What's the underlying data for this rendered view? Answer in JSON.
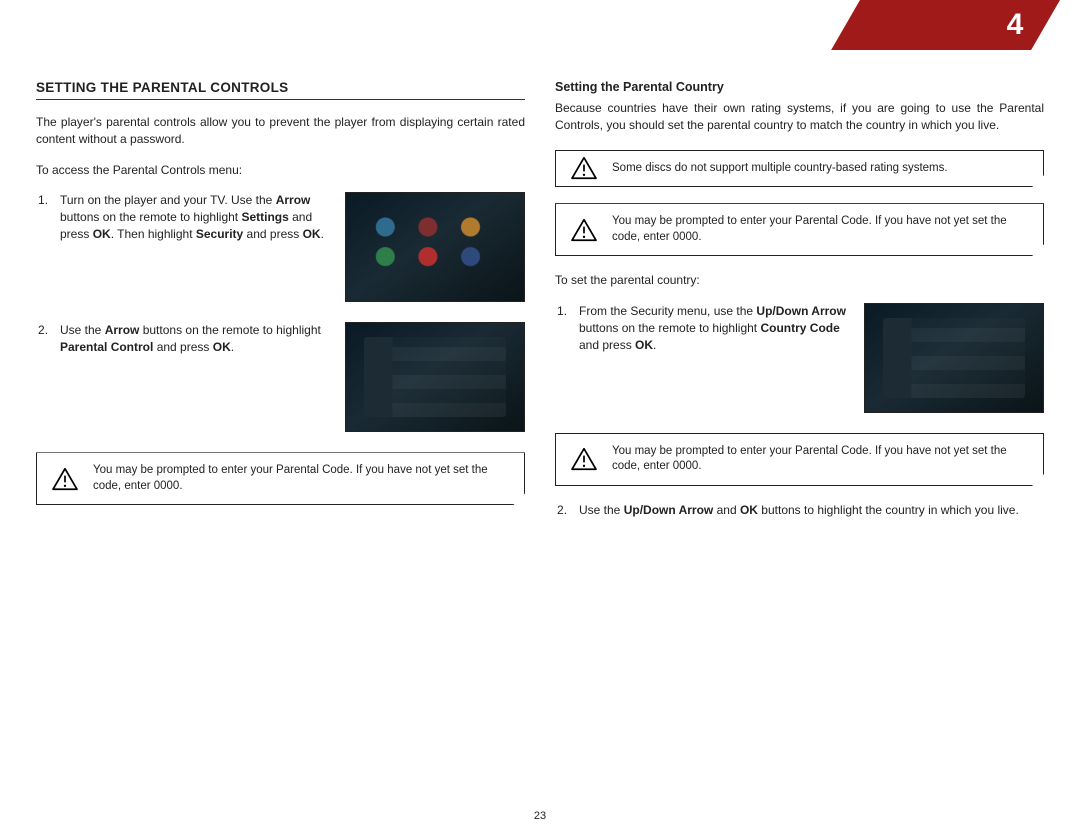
{
  "chapter_number": "4",
  "footer_page_number": "23",
  "left": {
    "heading": "SETTING THE PARENTAL CONTROLS",
    "intro": "The player's parental controls allow you to prevent the player from displaying certain rated content without a password.",
    "intro2": "To access the Parental Controls menu:",
    "step1_a": "Turn on the player and your TV. Use the ",
    "step1_b": "Arrow",
    "step1_c": " buttons on the remote to highlight ",
    "step1_d": "Settings",
    "step1_e": " and press ",
    "step1_f": "OK",
    "step1_g": ". Then highlight ",
    "step1_h": "Security",
    "step1_i": " and press ",
    "step1_j": "OK",
    "step1_k": ".",
    "step2_a": "Use the ",
    "step2_b": "Arrow",
    "step2_c": " buttons on the remote to highlight ",
    "step2_d": "Parental Control",
    "step2_e": " and press ",
    "step2_f": "OK",
    "step2_g": ".",
    "note": "You may be prompted to enter your Parental Code. If you have not yet set the code, enter 0000."
  },
  "right": {
    "heading": "Setting the Parental Country",
    "intro": "Because countries have their own rating systems, if you are going to use the Parental Controls, you should set the parental country to match the country in which you live.",
    "note1": "Some discs do not support multiple country-based rating systems.",
    "note2": "You may be prompted to enter your Parental Code. If you have not yet set the code, enter 0000.",
    "intro2": "To set the parental country:",
    "step1_a": "From the Security menu, use the ",
    "step1_b": "Up/Down Arrow",
    "step1_c": " buttons on the remote to highlight ",
    "step1_d": "Country Code",
    "step1_e": " and press ",
    "step1_f": "OK",
    "step1_g": ".",
    "note3": "You may be prompted to enter your Parental Code. If you have not yet set the code, enter 0000.",
    "step2_a": "Use the ",
    "step2_b": "Up/Down Arrow",
    "step2_c": " and ",
    "step2_d": "OK",
    "step2_e": " buttons to highlight the country in which you live."
  }
}
